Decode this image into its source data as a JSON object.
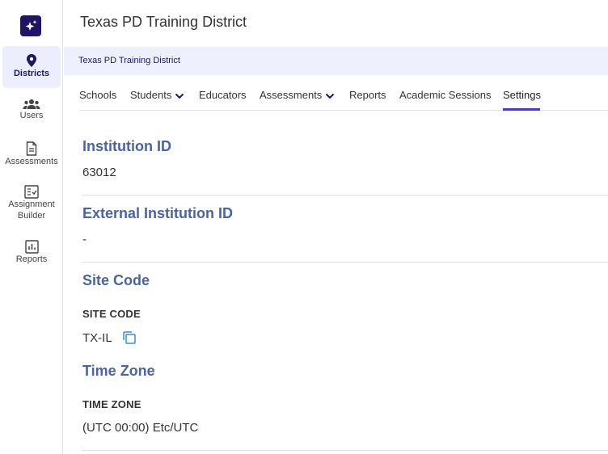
{
  "sidebar": {
    "items": [
      {
        "label": "Districts",
        "icon": "location-pin-icon",
        "active": true
      },
      {
        "label": "Users",
        "icon": "users-icon"
      },
      {
        "label": "Assessments",
        "icon": "document-icon"
      },
      {
        "label": "Assignment Builder",
        "label_line1": "Assignment",
        "label_line2": "Builder",
        "icon": "checklist-icon"
      },
      {
        "label": "Reports",
        "icon": "bar-chart-icon"
      }
    ]
  },
  "header": {
    "title": "Texas PD Training District",
    "breadcrumb": "Texas PD Training District"
  },
  "tabs": [
    {
      "label": "Schools"
    },
    {
      "label": "Students",
      "dropdown": true
    },
    {
      "label": "Educators"
    },
    {
      "label": "Assessments",
      "dropdown": true
    },
    {
      "label": "Reports"
    },
    {
      "label": "Academic Sessions"
    },
    {
      "label": "Settings",
      "active": true
    }
  ],
  "content": {
    "institution_id": {
      "title": "Institution ID",
      "value": "63012"
    },
    "external_institution_id": {
      "title": "External Institution ID",
      "value": "-"
    },
    "site_code": {
      "title": "Site Code",
      "label": "SITE CODE",
      "value": "TX-IL"
    },
    "time_zone": {
      "title": "Time Zone",
      "label": "TIME ZONE",
      "value": "(UTC 00:00) Etc/UTC"
    }
  },
  "colors": {
    "brand": "#1f1466",
    "accent": "#4a3bc0",
    "section_title": "#4a64a0",
    "banner_bg": "#eef0fe",
    "copy_icon": "#3a8fd0"
  }
}
